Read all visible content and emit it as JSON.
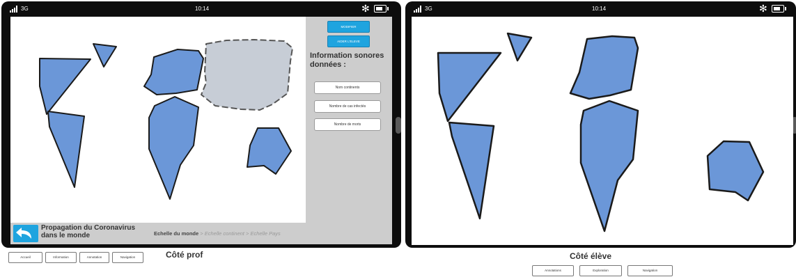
{
  "status_bar": {
    "network": "3G",
    "time": "10:14"
  },
  "prof": {
    "buttons": {
      "modifier": "MODIFIER",
      "aide": "AIDER L'ELEVE"
    },
    "info_title": "Information sonores données :",
    "info_buttons": [
      "Nom continents",
      "Nombre de cas infectés",
      "Nombre de morts"
    ],
    "bottom_title": "Propagation du Coronavirus dans le monde",
    "breadcrumb": {
      "current": "Echelle du monde",
      "sep1": " > ",
      "mid": "Echelle continent",
      "sep2": " > ",
      "last": "Echelle Pays"
    },
    "label": "Côté prof",
    "tabs": [
      "Accueil",
      "Information",
      "Annotation",
      "Navigation"
    ]
  },
  "eleve": {
    "label": "Côté élève",
    "tabs": [
      "Annotations",
      "Exploration",
      "Navigation"
    ]
  },
  "colors": {
    "continent_fill": "#6b97d8",
    "selected_fill": "#c7cdd6",
    "accent": "#1fa4df",
    "panel": "#cdcdcd"
  },
  "icons": [
    "signal-icon",
    "bluetooth-icon",
    "battery-icon",
    "back-arrow-icon"
  ]
}
